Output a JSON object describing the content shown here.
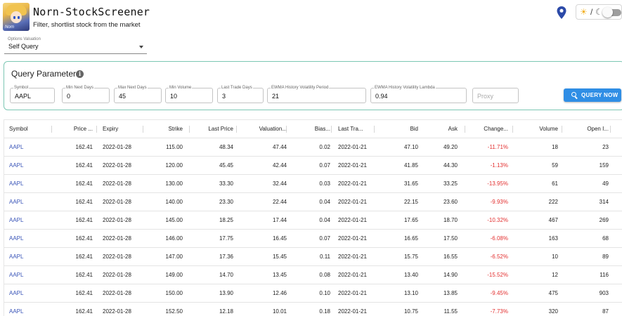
{
  "app": {
    "title": "Norn-StockScreener",
    "subtitle": "Filter, shortlist stock from the market",
    "avatar_text": "Norn"
  },
  "theme_toggle": {
    "separator": "/"
  },
  "options_select": {
    "label": "Options Valuation",
    "value": "Self Query"
  },
  "query_panel": {
    "title": "Query Parameters",
    "fields": {
      "symbol": {
        "label": "Symbol",
        "value": "AAPL"
      },
      "min_next_days": {
        "label": "Min Next Days",
        "value": "0"
      },
      "max_next_days": {
        "label": "Max Next Days",
        "value": "45"
      },
      "min_volume": {
        "label": "Min Volume",
        "value": "10"
      },
      "last_trade_days": {
        "label": "Last Trade Days",
        "value": "3"
      },
      "ewma_period": {
        "label": "EWMA History Volatility Period",
        "value": "21"
      },
      "ewma_lambda": {
        "label": "EWMA History Volatility Lambda",
        "value": "0.94"
      },
      "proxy": {
        "placeholder": "Proxy"
      }
    },
    "query_button": "QUERY NOW"
  },
  "table": {
    "columns": [
      "Symbol",
      "Price ...",
      "Expiry",
      "Strike",
      "Last Price",
      "Valuation...",
      "Bias...",
      "Last Tra...",
      "Bid",
      "Ask",
      "Change...",
      "Volume",
      "Open I..."
    ],
    "rows": [
      [
        "AAPL",
        "162.41",
        "2022-01-28",
        "115.00",
        "48.34",
        "47.44",
        "0.02",
        "2022-01-21",
        "47.10",
        "49.20",
        "-11.71%",
        "18",
        "23"
      ],
      [
        "AAPL",
        "162.41",
        "2022-01-28",
        "120.00",
        "45.45",
        "42.44",
        "0.07",
        "2022-01-21",
        "41.85",
        "44.30",
        "-1.13%",
        "59",
        "159"
      ],
      [
        "AAPL",
        "162.41",
        "2022-01-28",
        "130.00",
        "33.30",
        "32.44",
        "0.03",
        "2022-01-21",
        "31.65",
        "33.25",
        "-13.95%",
        "61",
        "49"
      ],
      [
        "AAPL",
        "162.41",
        "2022-01-28",
        "140.00",
        "23.30",
        "22.44",
        "0.04",
        "2022-01-21",
        "22.15",
        "23.60",
        "-9.93%",
        "222",
        "314"
      ],
      [
        "AAPL",
        "162.41",
        "2022-01-28",
        "145.00",
        "18.25",
        "17.44",
        "0.04",
        "2022-01-21",
        "17.65",
        "18.70",
        "-10.32%",
        "467",
        "269"
      ],
      [
        "AAPL",
        "162.41",
        "2022-01-28",
        "146.00",
        "17.75",
        "16.45",
        "0.07",
        "2022-01-21",
        "16.65",
        "17.50",
        "-6.08%",
        "163",
        "68"
      ],
      [
        "AAPL",
        "162.41",
        "2022-01-28",
        "147.00",
        "17.36",
        "15.45",
        "0.11",
        "2022-01-21",
        "15.75",
        "16.55",
        "-6.52%",
        "10",
        "89"
      ],
      [
        "AAPL",
        "162.41",
        "2022-01-28",
        "149.00",
        "14.70",
        "13.45",
        "0.08",
        "2022-01-21",
        "13.40",
        "14.90",
        "-15.52%",
        "12",
        "116"
      ],
      [
        "AAPL",
        "162.41",
        "2022-01-28",
        "150.00",
        "13.90",
        "12.46",
        "0.10",
        "2022-01-21",
        "13.10",
        "13.85",
        "-9.45%",
        "475",
        "903"
      ],
      [
        "AAPL",
        "162.41",
        "2022-01-28",
        "152.50",
        "12.18",
        "10.01",
        "0.18",
        "2022-01-21",
        "10.75",
        "11.55",
        "-7.73%",
        "320",
        "87"
      ]
    ]
  },
  "colors": {
    "accent": "#2f8ee5",
    "panel_border": "#7cc7b3",
    "symbol_link": "#3a55b8",
    "negative_change": "#e33131"
  },
  "icons": [
    "location-pin-icon",
    "sun-icon",
    "moon-icon",
    "info-icon",
    "search-icon"
  ]
}
